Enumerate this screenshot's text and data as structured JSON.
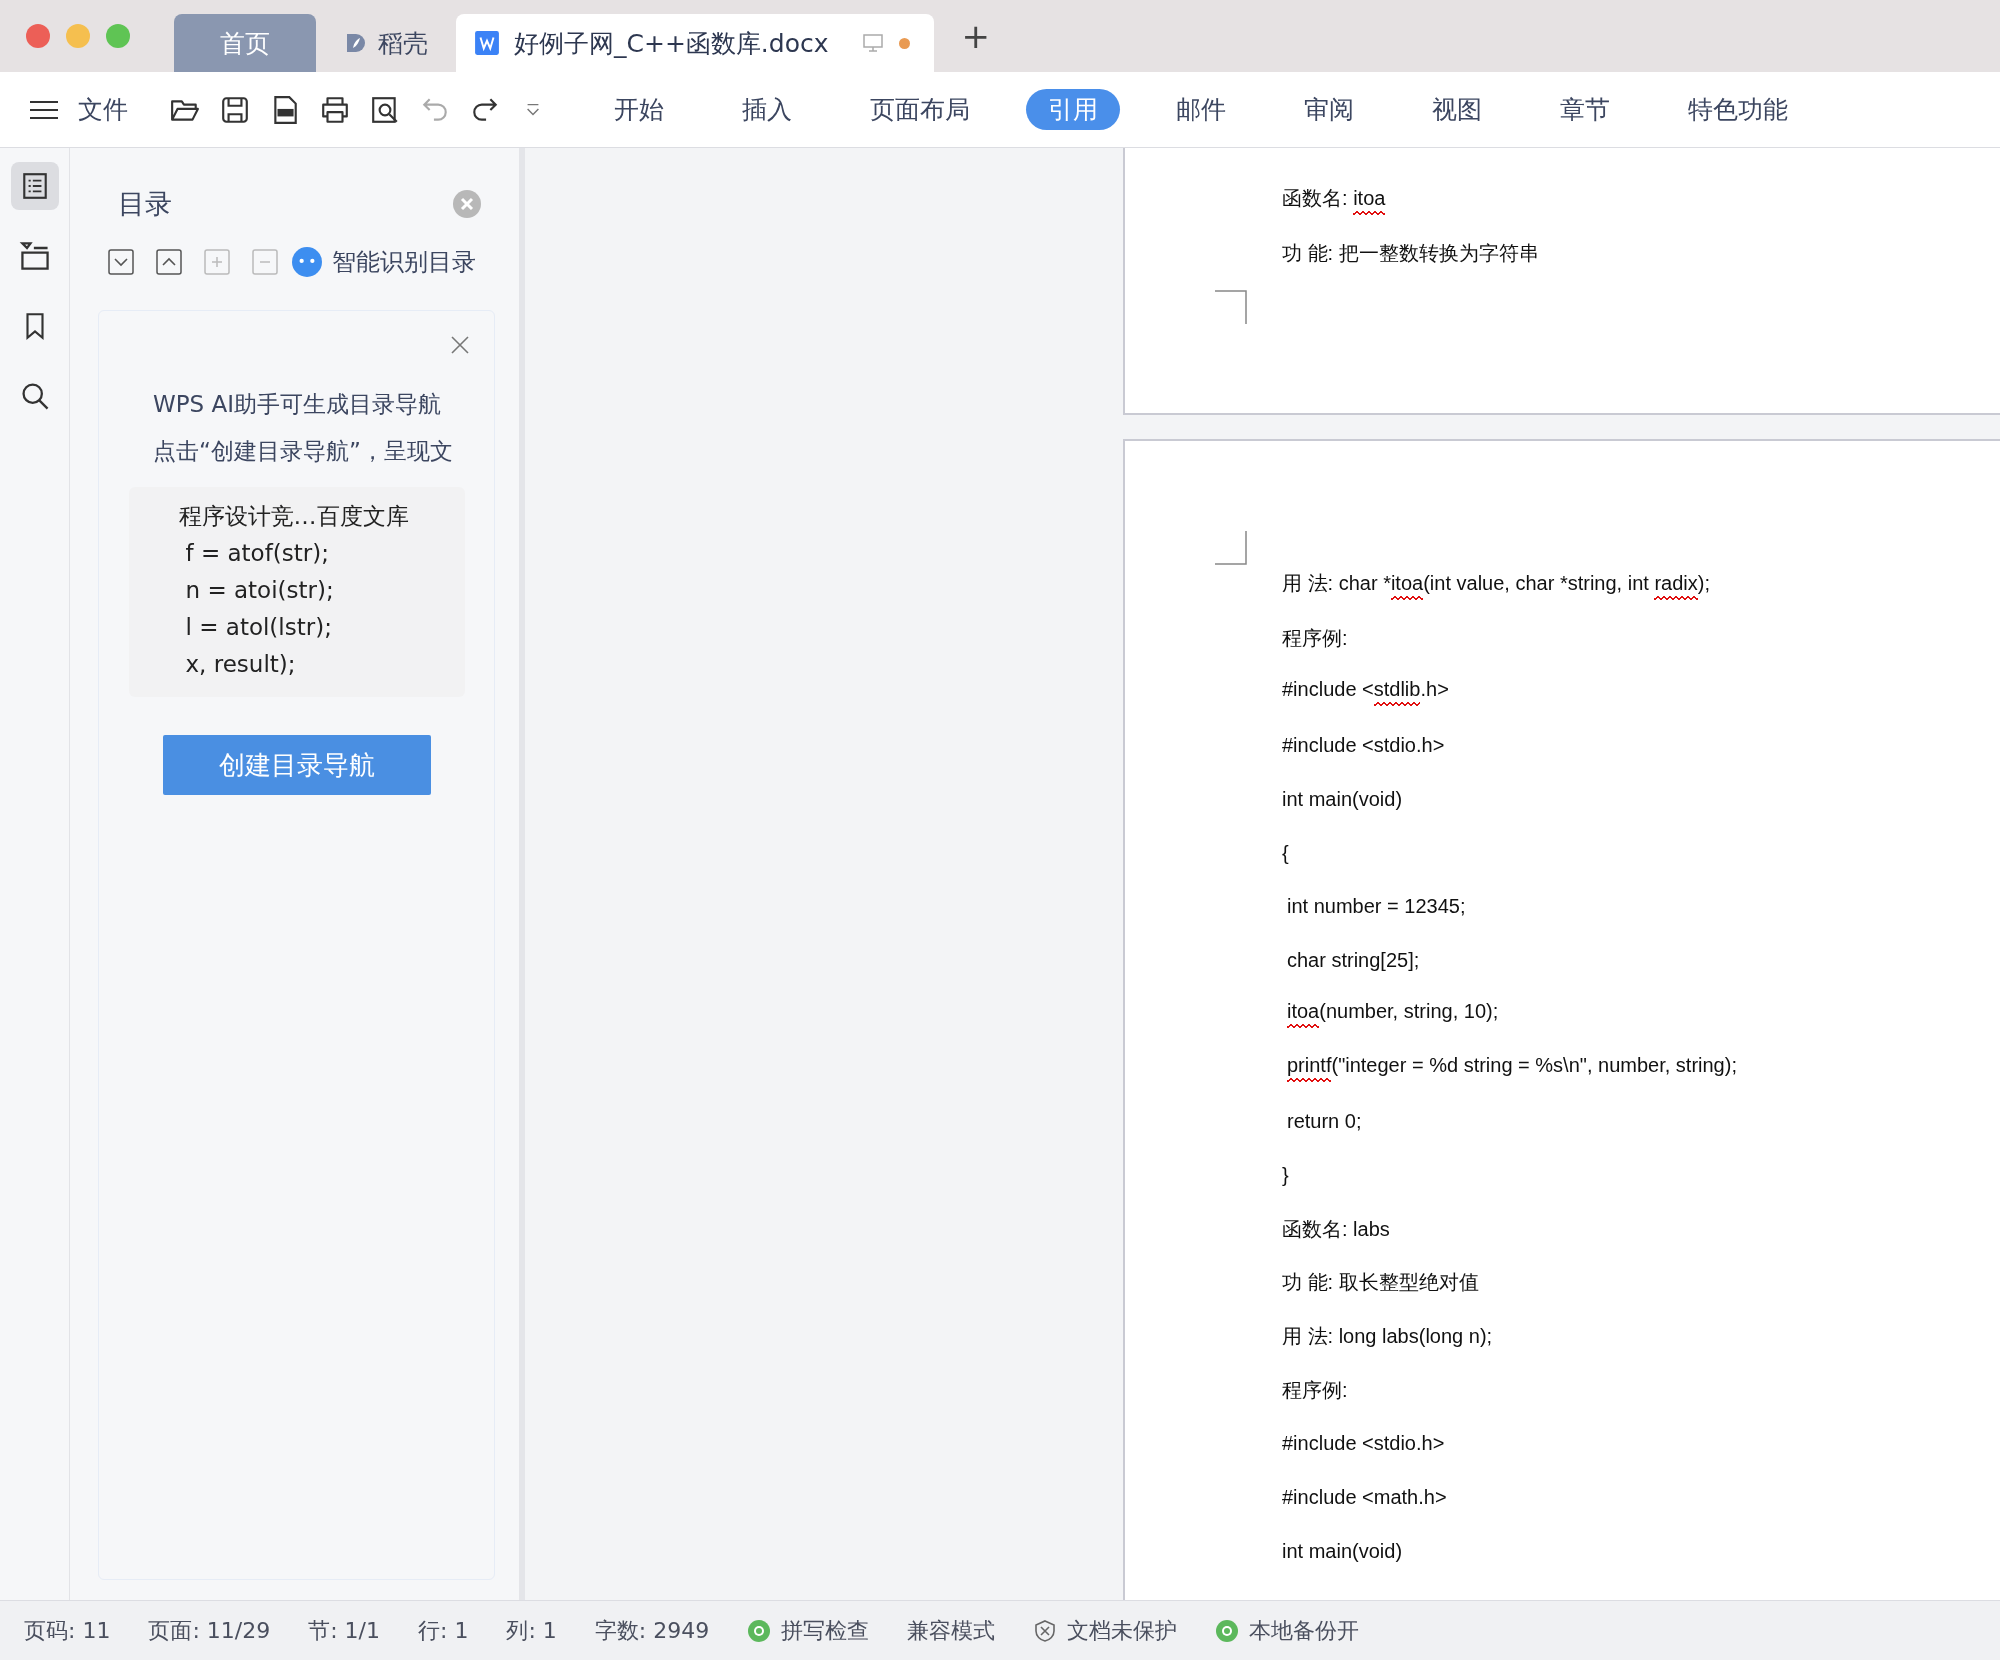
{
  "tabs": [
    {
      "label": "首页",
      "kind": "home",
      "selected": false
    },
    {
      "label": "稻壳",
      "kind": "docer",
      "selected": false
    },
    {
      "label": "好例子网_C++函数库.docx",
      "kind": "document",
      "selected": true,
      "unsaved": true
    }
  ],
  "new_tab": "+",
  "menu": {
    "label": "文件"
  },
  "quick_access": [
    {
      "kind": "open",
      "disabled": false
    },
    {
      "kind": "save",
      "disabled": false
    },
    {
      "kind": "pdf",
      "disabled": false
    },
    {
      "kind": "print",
      "disabled": false
    },
    {
      "kind": "preview",
      "disabled": false
    },
    {
      "kind": "undo",
      "disabled": true
    },
    {
      "kind": "redo",
      "disabled": false
    },
    {
      "kind": "more",
      "disabled": false
    }
  ],
  "ribbon_tabs": [
    {
      "label": "开始",
      "selected": false
    },
    {
      "label": "插入",
      "selected": false
    },
    {
      "label": "页面布局",
      "selected": false
    },
    {
      "label": "引用",
      "selected": true
    },
    {
      "label": "邮件",
      "selected": false
    },
    {
      "label": "审阅",
      "selected": false
    },
    {
      "label": "视图",
      "selected": false
    },
    {
      "label": "章节",
      "selected": false
    },
    {
      "label": "特色功能",
      "selected": false
    }
  ],
  "rail": [
    {
      "kind": "outline",
      "selected": true
    },
    {
      "kind": "navigation",
      "selected": false
    },
    {
      "kind": "bookmark",
      "selected": false
    },
    {
      "kind": "search",
      "selected": false
    }
  ],
  "outline_panel": {
    "title": "目录",
    "tools": [
      {
        "kind": "expand",
        "disabled": false
      },
      {
        "kind": "collapse",
        "disabled": false
      },
      {
        "kind": "add",
        "disabled": true
      },
      {
        "kind": "remove",
        "disabled": true
      }
    ],
    "smart_label": "智能识别目录",
    "card": {
      "lines": [
        "WPS AI助手可生成目录导航",
        "点击“创建目录导航”，呈现文"
      ],
      "preview": [
        "程序设计竞…百度文库",
        "f = atof(str);",
        "n = atoi(str);",
        "l = atol(lstr);",
        "x, result);"
      ],
      "button": "创建目录导航"
    }
  },
  "pages": [
    {
      "lines": [
        {
          "indented": false,
          "segs": [
            {
              "t": "函数名: ",
              "typo": false
            },
            {
              "t": "itoa",
              "typo": true
            }
          ]
        },
        {
          "indented": false,
          "segs": [
            {
              "t": "功 能: 把一整数转换为字符串",
              "typo": false
            }
          ]
        }
      ]
    },
    {
      "lines": [
        {
          "indented": false,
          "segs": [
            {
              "t": "用 法: char *",
              "typo": false
            },
            {
              "t": "itoa",
              "typo": true
            },
            {
              "t": "(int value, char *string, int ",
              "typo": false
            },
            {
              "t": "radix",
              "typo": true
            },
            {
              "t": ");",
              "typo": false
            }
          ]
        },
        {
          "indented": false,
          "segs": [
            {
              "t": "程序例:",
              "typo": false
            }
          ]
        },
        {
          "indented": false,
          "segs": [
            {
              "t": "#include <",
              "typo": false
            },
            {
              "t": "stdlib",
              "typo": true
            },
            {
              "t": ".h>",
              "typo": false
            }
          ]
        },
        {
          "indented": false,
          "segs": [
            {
              "t": "#include <stdio.h>",
              "typo": false
            }
          ]
        },
        {
          "indented": false,
          "segs": [
            {
              "t": "int main(void)",
              "typo": false
            }
          ]
        },
        {
          "indented": false,
          "segs": [
            {
              "t": "{",
              "typo": false
            }
          ]
        },
        {
          "indented": true,
          "segs": [
            {
              "t": "int number = 12345;",
              "typo": false
            }
          ]
        },
        {
          "indented": true,
          "segs": [
            {
              "t": "char string[25];",
              "typo": false
            }
          ]
        },
        {
          "indented": true,
          "segs": [
            {
              "t": "itoa",
              "typo": true
            },
            {
              "t": "(number, string, 10);",
              "typo": false
            }
          ]
        },
        {
          "indented": true,
          "segs": [
            {
              "t": "printf",
              "typo": true
            },
            {
              "t": "(\"integer = %d string = %s\\n\", number, string);",
              "typo": false
            }
          ]
        },
        {
          "indented": true,
          "segs": [
            {
              "t": "return 0;",
              "typo": false
            }
          ]
        },
        {
          "indented": false,
          "segs": [
            {
              "t": "}",
              "typo": false
            }
          ]
        },
        {
          "indented": false,
          "segs": [
            {
              "t": "函数名: labs",
              "typo": false
            }
          ]
        },
        {
          "indented": false,
          "segs": [
            {
              "t": "功 能: 取长整型绝对值",
              "typo": false
            }
          ]
        },
        {
          "indented": false,
          "segs": [
            {
              "t": "用 法: long labs(long n);",
              "typo": false
            }
          ]
        },
        {
          "indented": false,
          "segs": [
            {
              "t": "程序例:",
              "typo": false
            }
          ]
        },
        {
          "indented": false,
          "segs": [
            {
              "t": "#include <stdio.h>",
              "typo": false
            }
          ]
        },
        {
          "indented": false,
          "segs": [
            {
              "t": "#include <math.h>",
              "typo": false
            }
          ]
        },
        {
          "indented": false,
          "segs": [
            {
              "t": "int main(void)",
              "typo": false
            }
          ]
        }
      ]
    }
  ],
  "status_bar": [
    {
      "text": "页码: 11",
      "kind": "text"
    },
    {
      "text": "页面: 11/29",
      "kind": "text"
    },
    {
      "text": "节: 1/1",
      "kind": "text"
    },
    {
      "text": "行: 1",
      "kind": "text"
    },
    {
      "text": "列: 1",
      "kind": "text"
    },
    {
      "text": "字数: 2949",
      "kind": "text"
    },
    {
      "text": "拼写检查",
      "kind": "ok"
    },
    {
      "text": "兼容模式",
      "kind": "text"
    },
    {
      "text": "文档未保护",
      "kind": "shield"
    },
    {
      "text": "本地备份开",
      "kind": "ok"
    }
  ]
}
